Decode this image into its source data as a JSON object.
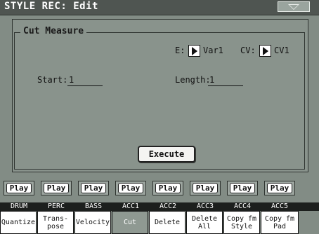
{
  "header": {
    "title": "STYLE REC: Edit",
    "menu_icon": "triangle-down-icon"
  },
  "group": {
    "title": "Cut Measure"
  },
  "fields": {
    "e_label": "E:",
    "e_value": "Var1",
    "cv_label": "CV:",
    "cv_value": "CV1",
    "start_label": "Start:",
    "start_value": "1",
    "length_label": "Length:",
    "length_value": "1"
  },
  "execute_label": "Execute",
  "play_buttons": [
    "Play",
    "Play",
    "Play",
    "Play",
    "Play",
    "Play",
    "Play",
    "Play"
  ],
  "tracks": [
    "DRUM",
    "PERC",
    "BASS",
    "ACC1",
    "ACC2",
    "ACC3",
    "ACC4",
    "ACC5"
  ],
  "tabs": [
    "Quantize",
    "Trans-\npose",
    "Velocity",
    "Cut",
    "Delete",
    "Delete\nAll",
    "Copy fm\nStyle",
    "Copy fm\nPad"
  ],
  "active_tab": "Cut",
  "colors": {
    "background": "#828c85",
    "titlebar": "#4f5551",
    "active_tab": "#8f9992"
  }
}
